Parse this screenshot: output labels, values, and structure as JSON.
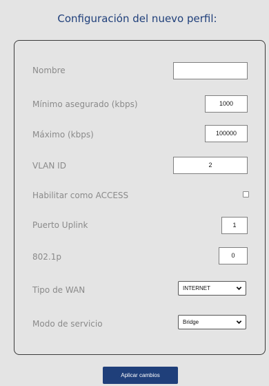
{
  "title": "Configuración del nuevo perfil:",
  "fields": {
    "nombre": {
      "label": "Nombre",
      "value": ""
    },
    "minimo": {
      "label": "Mínimo asegurado (kbps)",
      "value": "1000"
    },
    "maximo": {
      "label": "Máximo (kbps)",
      "value": "100000"
    },
    "vlan": {
      "label": "VLAN ID",
      "value": "2"
    },
    "access": {
      "label": "Habilitar como ACCESS",
      "checked": false
    },
    "uplink": {
      "label": "Puerto Uplink",
      "value": "1"
    },
    "p8021": {
      "label": "802.1p",
      "value": "0"
    },
    "wan": {
      "label": "Tipo de WAN",
      "selected": "INTERNET"
    },
    "modo": {
      "label": "Modo de servicio",
      "selected": "Bridge"
    }
  },
  "apply_button": "Aplicar cambios"
}
